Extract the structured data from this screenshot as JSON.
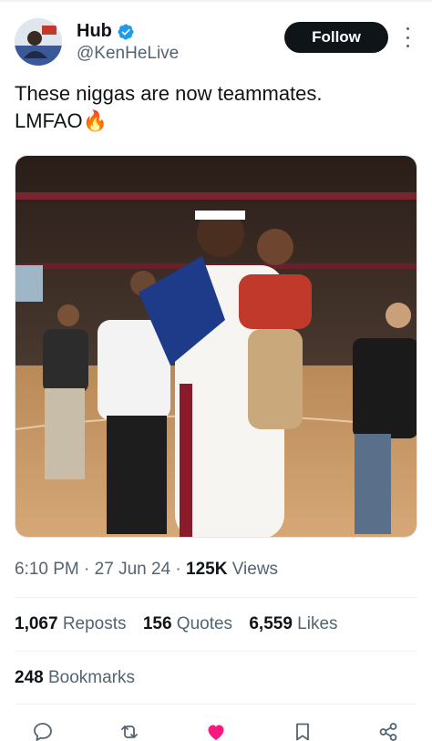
{
  "author": {
    "name": "Hub",
    "handle": "@KenHeLive",
    "verified": true,
    "avatar_icon": "avatar"
  },
  "follow_label": "Follow",
  "tweet": {
    "line1": "These niggas are now teammates.",
    "line2": "LMFAO🔥"
  },
  "meta": {
    "time": "6:10 PM",
    "sep1": "·",
    "date": "27 Jun 24",
    "sep2": "·",
    "views_count": "125K",
    "views_label": "Views"
  },
  "stats": {
    "reposts_count": "1,067",
    "reposts_label": "Reposts",
    "quotes_count": "156",
    "quotes_label": "Quotes",
    "likes_count": "6,559",
    "likes_label": "Likes",
    "bookmarks_count": "248",
    "bookmarks_label": "Bookmarks"
  },
  "actions": {
    "reply_icon": "reply-icon",
    "repost_icon": "repost-icon",
    "like_icon": "heart-icon",
    "bookmark_icon": "bookmark-icon",
    "share_icon": "share-icon"
  },
  "colors": {
    "text": "#0f1419",
    "secondary": "#536471",
    "verified": "#1d9bf0",
    "like_active": "#f91880",
    "repost": "#536471",
    "divider": "#eff3f4"
  }
}
